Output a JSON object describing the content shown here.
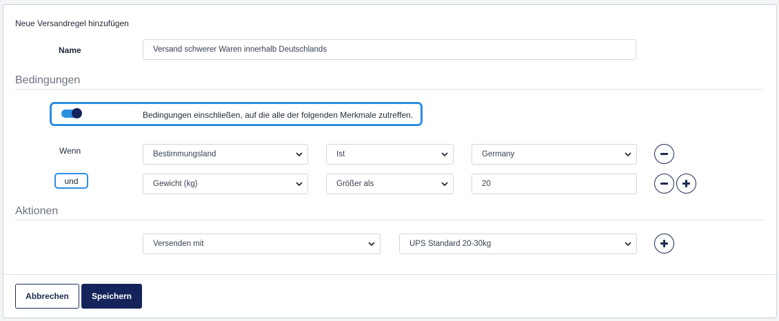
{
  "dialog": {
    "title": "Neue Versandregel hinzufügen"
  },
  "name_field": {
    "label": "Name",
    "value": "Versand schwerer Waren innerhalb Deutschlands"
  },
  "conditions": {
    "title": "Bedingungen",
    "toggle": {
      "checked": true,
      "text": "Bedingungen einschließen, auf die alle der folgenden Merkmale zutreffen."
    },
    "rows": [
      {
        "prefix": "Wenn",
        "attribute": "Bestimmungsland",
        "operator": "Ist",
        "value": "Germany"
      },
      {
        "prefix": "und",
        "attribute": "Gewicht (kg)",
        "operator": "Größer als",
        "value": "20"
      }
    ]
  },
  "actions": {
    "title": "Aktionen",
    "rows": [
      {
        "action": "Versenden mit",
        "value": "UPS Standard 20-30kg"
      }
    ]
  },
  "footer": {
    "cancel_label": "Abbrechen",
    "save_label": "Speichern"
  },
  "colors": {
    "accent": "#2b8ee0",
    "primary": "#14245a",
    "border": "#cfd6df"
  },
  "icons": {
    "remove": "minus-circle-icon",
    "add": "plus-circle-icon",
    "dropdown": "chevron-down-icon"
  }
}
